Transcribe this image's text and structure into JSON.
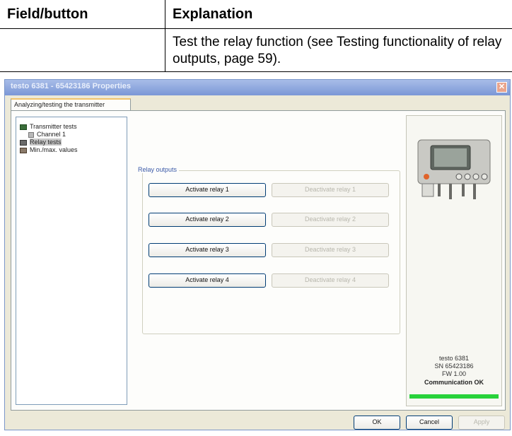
{
  "doc_table": {
    "col1_header": "Field/button",
    "col2_header": "Explanation",
    "row_text": "Test the relay function (see Testing functionality of relay outputs, page 59)."
  },
  "dialog": {
    "title": "testo 6381 - 65423186 Properties",
    "close_glyph": "✕",
    "tab_label": "Analyzing/testing the transmitter",
    "tree": [
      {
        "label": "Transmitter tests",
        "icon": "tester-icon"
      },
      {
        "label": "Channel 1",
        "icon": "channel-icon"
      },
      {
        "label": "Relay tests",
        "icon": "relay-icon",
        "selected": true
      },
      {
        "label": "Min./max. values",
        "icon": "minmax-icon"
      }
    ],
    "relay_group_label": "Relay outputs",
    "relays": [
      {
        "activate": "Activate relay 1",
        "deactivate": "Deactivate relay 1"
      },
      {
        "activate": "Activate relay 2",
        "deactivate": "Deactivate relay 2"
      },
      {
        "activate": "Activate relay 3",
        "deactivate": "Deactivate relay 3"
      },
      {
        "activate": "Activate relay 4",
        "deactivate": "Deactivate relay 4"
      }
    ],
    "device": {
      "model": "testo 6381",
      "serial": "SN 65423186",
      "firmware": "FW 1.00",
      "status": "Communication OK",
      "status_color": "#27d23a"
    },
    "footer": {
      "ok": "OK",
      "cancel": "Cancel",
      "apply": "Apply"
    }
  }
}
